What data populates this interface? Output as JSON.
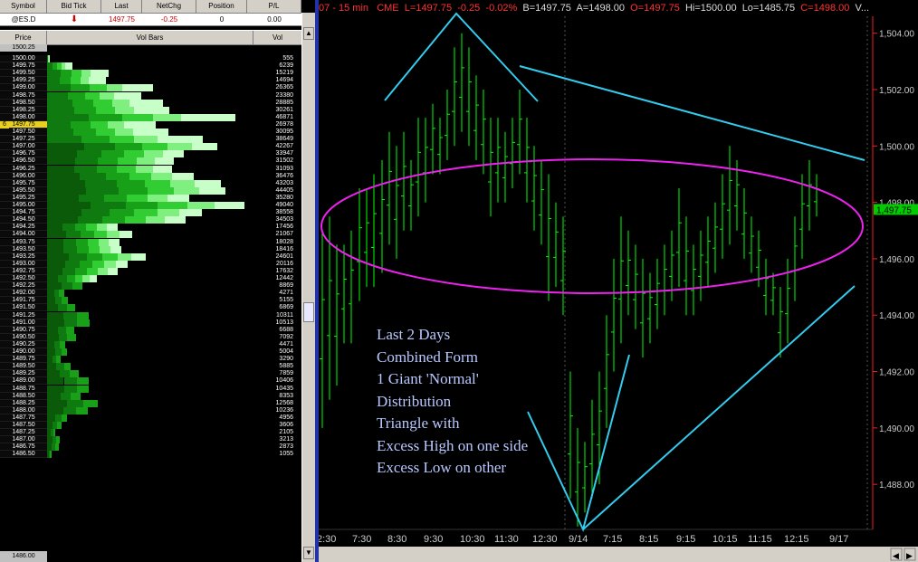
{
  "quote_header": {
    "columns": [
      "Symbol",
      "Bid Tick",
      "Last",
      "NetChg",
      "Position",
      "P/L"
    ],
    "row": {
      "symbol": "@ES.D",
      "bid_tick": "⬇",
      "last": "1497.75",
      "netchg": "-0.25",
      "position": "0",
      "pl": "0.00"
    }
  },
  "ladder": {
    "columns": [
      "Price",
      "Vol Bars",
      "Vol"
    ],
    "top_price": "1500.25",
    "bottom_price": "1486.00",
    "current_price_marker": "6",
    "last_price": "1497.75",
    "rows": [
      {
        "price": "1500.00",
        "vol": "555"
      },
      {
        "price": "1499.75",
        "vol": "6239"
      },
      {
        "price": "1499.50",
        "vol": "15219"
      },
      {
        "price": "1499.25",
        "vol": "14694"
      },
      {
        "price": "1499.00",
        "vol": "26365"
      },
      {
        "price": "1498.75",
        "vol": "23380"
      },
      {
        "price": "1498.50",
        "vol": "28885"
      },
      {
        "price": "1498.25",
        "vol": "30261"
      },
      {
        "price": "1498.00",
        "vol": "46871"
      },
      {
        "price": "1497.75",
        "vol": "26978"
      },
      {
        "price": "1497.50",
        "vol": "30095"
      },
      {
        "price": "1497.25",
        "vol": "38649"
      },
      {
        "price": "1497.00",
        "vol": "42267"
      },
      {
        "price": "1496.75",
        "vol": "33947"
      },
      {
        "price": "1496.50",
        "vol": "31502"
      },
      {
        "price": "1496.25",
        "vol": "31093"
      },
      {
        "price": "1496.00",
        "vol": "36476"
      },
      {
        "price": "1495.75",
        "vol": "43203"
      },
      {
        "price": "1495.50",
        "vol": "44405"
      },
      {
        "price": "1495.25",
        "vol": "35280"
      },
      {
        "price": "1495.00",
        "vol": "49040"
      },
      {
        "price": "1494.75",
        "vol": "38558"
      },
      {
        "price": "1494.50",
        "vol": "34503"
      },
      {
        "price": "1494.25",
        "vol": "17456"
      },
      {
        "price": "1494.00",
        "vol": "21067"
      },
      {
        "price": "1493.75",
        "vol": "18028"
      },
      {
        "price": "1493.50",
        "vol": "18416"
      },
      {
        "price": "1493.25",
        "vol": "24601"
      },
      {
        "price": "1493.00",
        "vol": "20116"
      },
      {
        "price": "1492.75",
        "vol": "17632"
      },
      {
        "price": "1492.50",
        "vol": "12442"
      },
      {
        "price": "1492.25",
        "vol": "8869"
      },
      {
        "price": "1492.00",
        "vol": "4271"
      },
      {
        "price": "1491.75",
        "vol": "5155"
      },
      {
        "price": "1491.50",
        "vol": "6869"
      },
      {
        "price": "1491.25",
        "vol": "10311"
      },
      {
        "price": "1491.00",
        "vol": "10513"
      },
      {
        "price": "1490.75",
        "vol": "6688"
      },
      {
        "price": "1490.50",
        "vol": "7092"
      },
      {
        "price": "1490.25",
        "vol": "4471"
      },
      {
        "price": "1490.00",
        "vol": "5004"
      },
      {
        "price": "1489.75",
        "vol": "3290"
      },
      {
        "price": "1489.50",
        "vol": "5885"
      },
      {
        "price": "1489.25",
        "vol": "7859"
      },
      {
        "price": "1489.00",
        "vol": "10406"
      },
      {
        "price": "1488.75",
        "vol": "10435"
      },
      {
        "price": "1488.50",
        "vol": "8353"
      },
      {
        "price": "1488.25",
        "vol": "12568"
      },
      {
        "price": "1488.00",
        "vol": "10236"
      },
      {
        "price": "1487.75",
        "vol": "4956"
      },
      {
        "price": "1487.50",
        "vol": "3606"
      },
      {
        "price": "1487.25",
        "vol": "2105"
      },
      {
        "price": "1487.00",
        "vol": "3213"
      },
      {
        "price": "1486.75",
        "vol": "2873"
      },
      {
        "price": "1486.50",
        "vol": "1055"
      }
    ]
  },
  "chart_header": {
    "prefix": "07 - 15 min",
    "exchange": "CME",
    "l": "L=1497.75",
    "chg": "-0.25",
    "pct": "-0.02%",
    "b": "B=1497.75",
    "a": "A=1498.00",
    "o": "O=1497.75",
    "hi": "Hi=1500.00",
    "lo": "Lo=1485.75",
    "c": "C=1498.00",
    "v": "V..."
  },
  "chart_data": {
    "type": "ohlc",
    "y_ticks": [
      "1,504.00",
      "1,502.00",
      "1,500.00",
      "1,498.00",
      "1,496.00",
      "1,494.00",
      "1,492.00",
      "1,490.00",
      "1,488.00"
    ],
    "last_price_label": "1,497.75",
    "x_ticks": [
      "2:30",
      "7:30",
      "8:30",
      "9:30",
      "10:30",
      "11:30",
      "12:30",
      "9/14",
      "7:15",
      "8:15",
      "9:15",
      "10:15",
      "11:15",
      "12:15",
      "9/17"
    ],
    "ylim": [
      1486.4,
      1504.6
    ],
    "colors": {
      "bars": "#00ff00",
      "lines": "#33ccee",
      "ellipse": "#ee22ee",
      "annotation": "#b8c8ff",
      "axis": "#ee2222"
    }
  },
  "annotation": {
    "lines": [
      "Last 2 Days",
      "Combined Form",
      "1 Giant 'Normal'",
      "Distribution",
      "Triangle with",
      "Excess High on one side",
      "Excess Low on other"
    ]
  }
}
